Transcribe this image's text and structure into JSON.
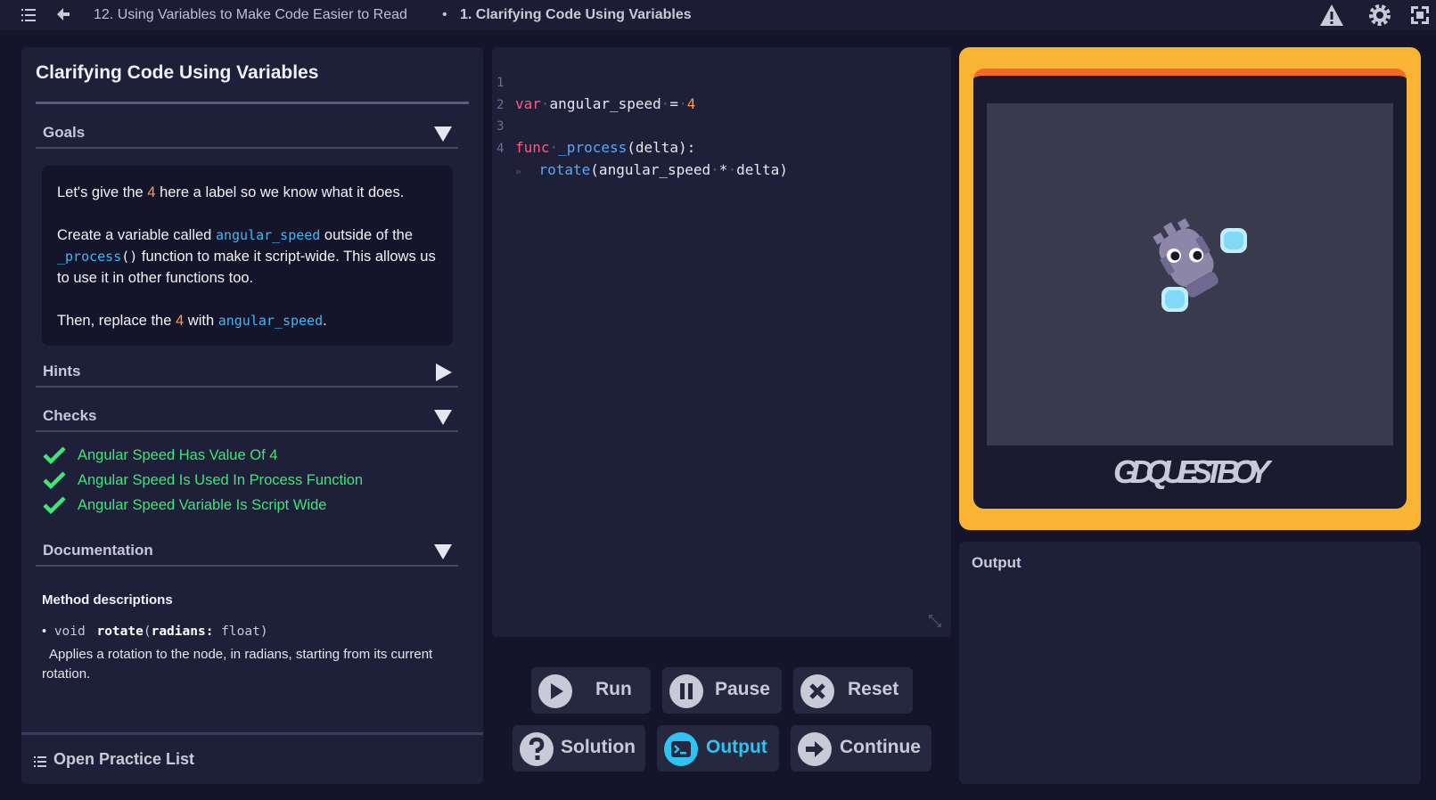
{
  "topbar": {
    "course": "12. Using Variables to Make Code Easier to Read",
    "separator": "•",
    "current": "1. Clarifying Code Using Variables"
  },
  "lesson": {
    "title": "Clarifying Code Using Variables"
  },
  "sections": {
    "goals": "Goals",
    "hints": "Hints",
    "checks": "Checks",
    "documentation": "Documentation"
  },
  "goals": {
    "p1_a": "Let's give the ",
    "p1_num": "4",
    "p1_b": " here a label so we know what it does.",
    "p2_a": "Create a variable called ",
    "p2_code": "angular_speed",
    "p2_b": " outside of the ",
    "p2_code2": "_process",
    "p2_parens": "()",
    "p2_c": " function to make it script-wide. This allows us to use it in other functions too.",
    "p3_a": "Then, replace the ",
    "p3_num": "4",
    "p3_b": " with ",
    "p3_code": "angular_speed",
    "p3_c": "."
  },
  "checks": [
    "Angular Speed Has Value Of 4",
    "Angular Speed Is Used In Process Function",
    "Angular Speed Variable Is Script Wide"
  ],
  "documentation": {
    "heading": "Method descriptions",
    "bullet": "•",
    "return_type": "void",
    "method": "rotate",
    "param": "radians:",
    "param_type": "float",
    "description": "Applies a rotation to the node, in radians, starting from its current rotation."
  },
  "open_list": "Open Practice List",
  "editor": {
    "line_numbers": [
      "1",
      "2",
      "3",
      "4"
    ],
    "l1_kw": "var",
    "l1_name": "angular_speed",
    "l1_eq": "=",
    "l1_val": "4",
    "l3_kw": "func",
    "l3_fn": "_process",
    "l3_args": "(delta):",
    "l4_fn": "rotate",
    "l4_a": "(angular_speed",
    "l4_op": "*",
    "l4_b": "delta)"
  },
  "buttons": {
    "run": "Run",
    "pause": "Pause",
    "reset": "Reset",
    "solution": "Solution",
    "output": "Output",
    "continue": "Continue"
  },
  "game": {
    "logo_text": "GDQUEST BOY"
  },
  "output": {
    "title": "Output"
  },
  "colors": {
    "accent_orange": "#f9b434",
    "check_green": "#3ee676",
    "output_active": "#2ec3f2",
    "number": "#ff9a3d",
    "keyword": "#ff5a7a",
    "function": "#57a9f5"
  },
  "icons": {
    "menu": "menu-icon",
    "back": "back-arrow-icon",
    "warning": "warning-icon",
    "settings": "gear-icon",
    "fullscreen": "fullscreen-icon",
    "goals_toggle": "triangle-down-icon",
    "hints_toggle": "triangle-right-icon",
    "check": "checkmark-icon",
    "list": "list-icon",
    "run": "play-icon",
    "pause": "pause-icon",
    "reset": "x-circle-icon",
    "solution": "question-icon",
    "output": "terminal-icon",
    "continue": "arrow-right-icon",
    "resize": "resize-icon"
  }
}
